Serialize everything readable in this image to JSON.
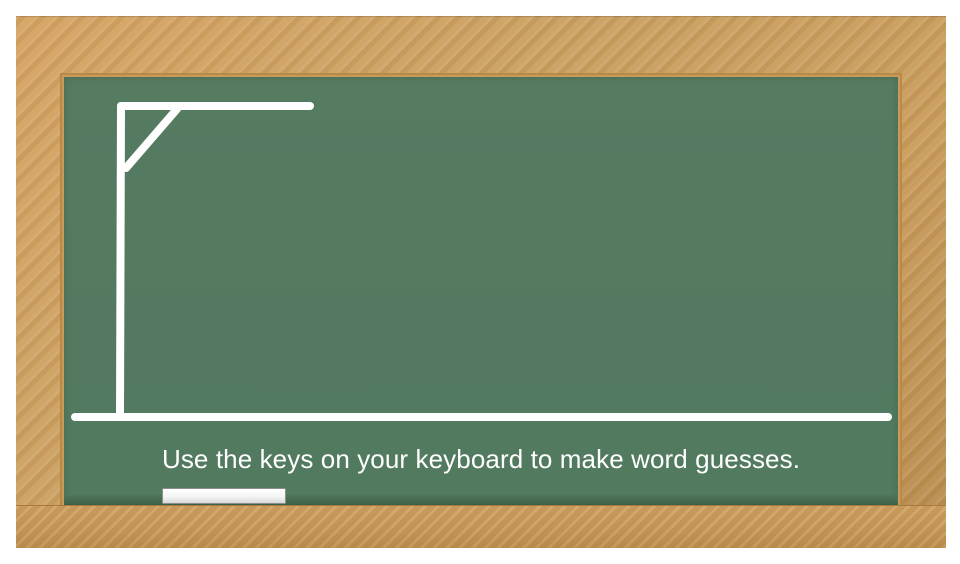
{
  "game": {
    "instructions": "Use the keys on your keyboard to make word guesses."
  },
  "colors": {
    "chalkboard": "#537a60",
    "frame_wood": "#c99c5b",
    "chalk": "#ffffff"
  },
  "icons": {
    "gallows": "gallows-drawing",
    "chalk": "chalk-stick"
  }
}
